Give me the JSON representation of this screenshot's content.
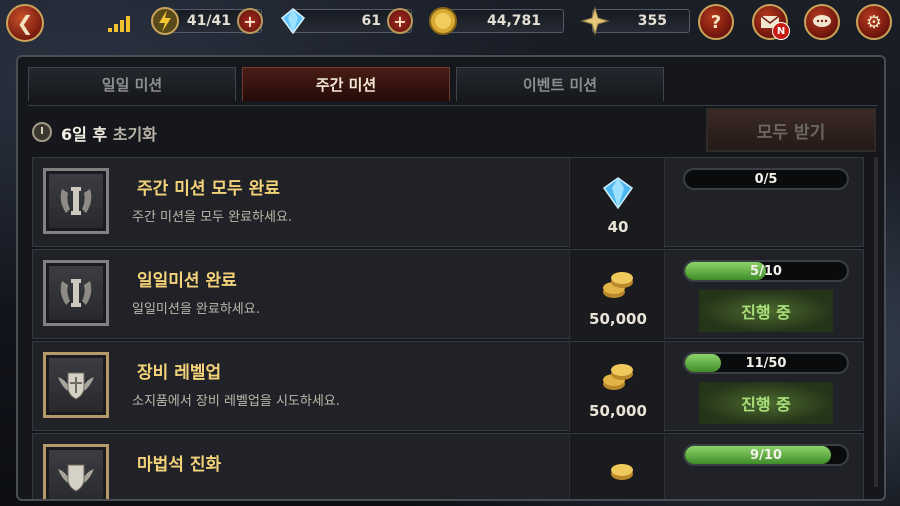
{
  "topbar": {
    "energy": "41/41",
    "gems": "61",
    "gold": "44,781",
    "honor": "355",
    "icons": [
      "back-arrow-icon",
      "signal-icon",
      "lightning-icon",
      "gem-icon",
      "gold-coin-icon",
      "compass-star-icon",
      "help-icon",
      "mail-icon",
      "chat-icon",
      "gear-icon"
    ],
    "mail_badge": "N",
    "help_label": "?"
  },
  "tabs": [
    {
      "label": "일일 미션",
      "active": false
    },
    {
      "label": "주간 미션",
      "active": true
    },
    {
      "label": "이벤트 미션",
      "active": false
    }
  ],
  "header": {
    "reset_days": "6일 후",
    "reset_label": "초기화",
    "claim_all": "모두 받기"
  },
  "missions": [
    {
      "title": "주간 미션 모두 완료",
      "desc": "주간 미션을 모두 완료하세요.",
      "reward_type": "gem",
      "reward": "40",
      "progress": "0/5",
      "progress_value": 0,
      "status": ""
    },
    {
      "title": "일일미션 완료",
      "desc": "일일미션을 완료하세요.",
      "reward_type": "gold",
      "reward": "50,000",
      "progress": "5/10",
      "progress_value": 0.5,
      "status": "진행 중"
    },
    {
      "title": "장비 레벨업",
      "desc": "소지품에서 장비 레벨업을 시도하세요.",
      "reward_type": "gold",
      "reward": "50,000",
      "progress": "11/50",
      "progress_value": 0.22,
      "status": "진행 중"
    },
    {
      "title": "마법석 진화",
      "desc": "",
      "reward_type": "gold",
      "reward": "",
      "progress": "9/10",
      "progress_value": 0.9,
      "status": ""
    }
  ],
  "colors": {
    "accent_red": "#7a1c10",
    "gold_text": "#f3d27a",
    "progress_green": "#3f8d28"
  }
}
